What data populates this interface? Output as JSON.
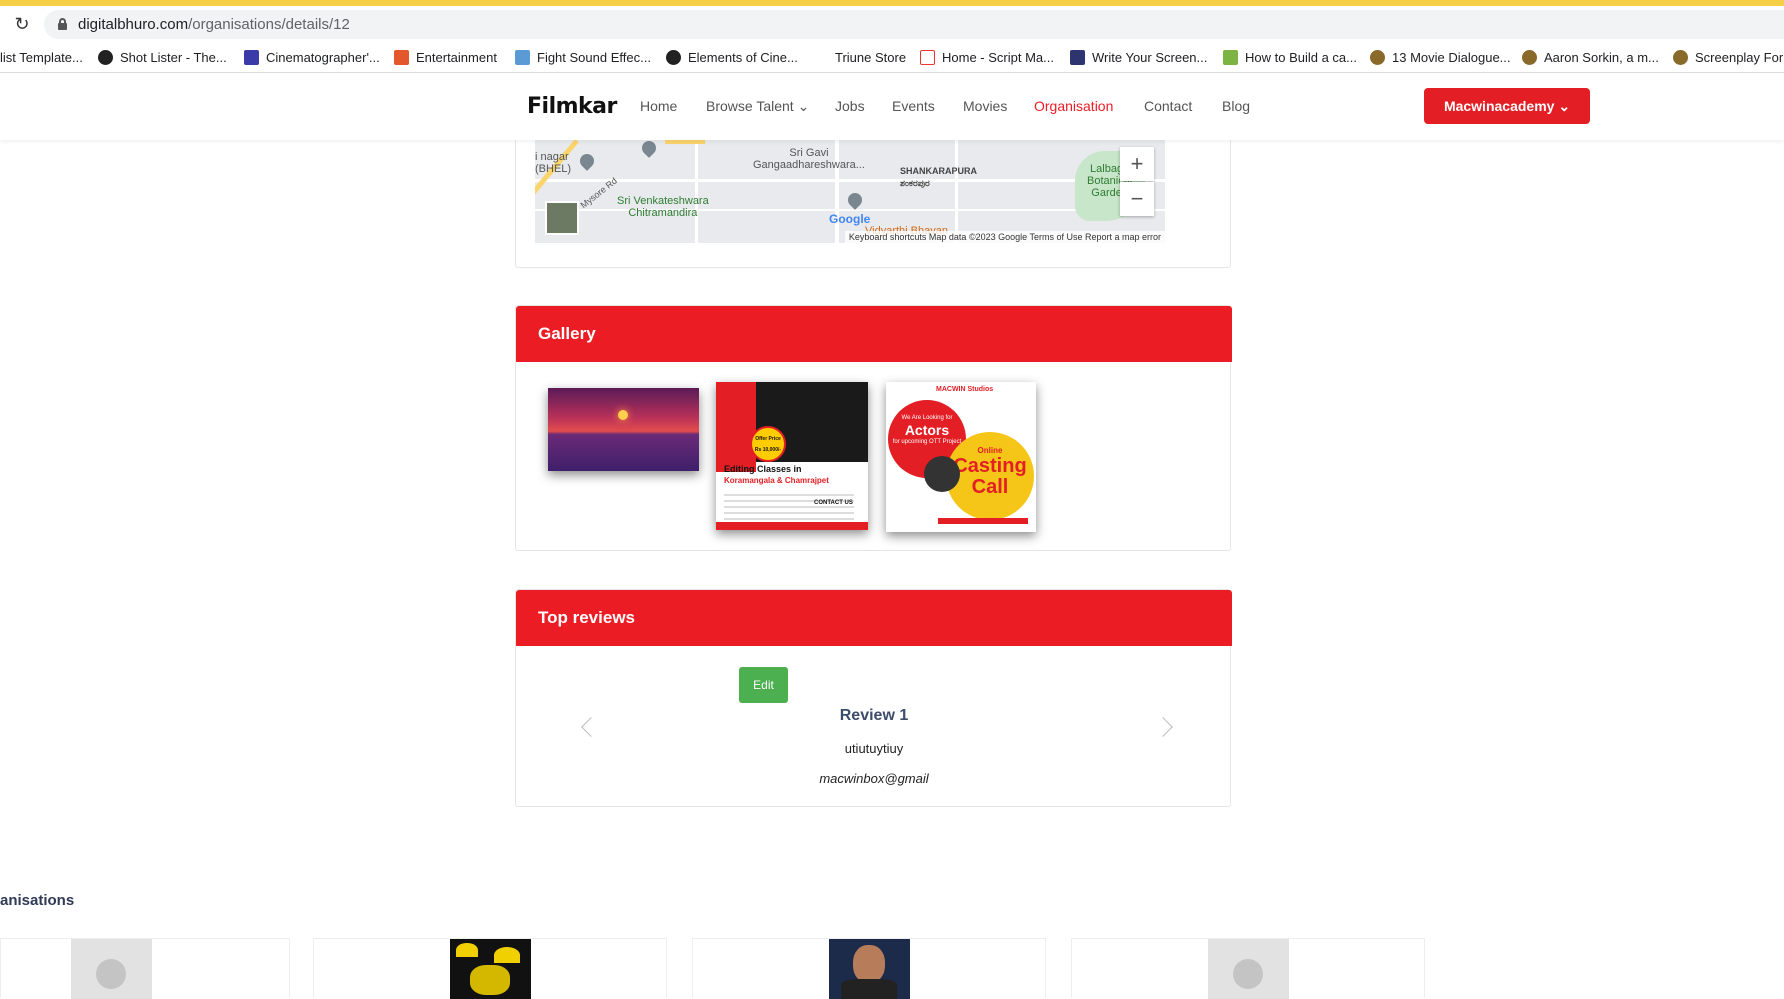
{
  "browser": {
    "url_domain": "digitalbhuro.com",
    "url_path": "/organisations/details/12",
    "bookmarks": [
      {
        "label": "list Template..."
      },
      {
        "label": "Shot Lister - The..."
      },
      {
        "label": "Cinematographer'..."
      },
      {
        "label": "Entertainment"
      },
      {
        "label": "Fight Sound Effec..."
      },
      {
        "label": "Elements of Cine..."
      },
      {
        "label": "Triune Store"
      },
      {
        "label": "Home - Script Ma..."
      },
      {
        "label": "Write Your Screen..."
      },
      {
        "label": "How to Build a ca..."
      },
      {
        "label": "13 Movie Dialogue..."
      },
      {
        "label": "Aaron Sorkin, a m..."
      },
      {
        "label": "Screenplay Form"
      }
    ]
  },
  "header": {
    "logo": "Filmkar",
    "nav": [
      {
        "label": "Home"
      },
      {
        "label": "Browse Talent ⌄"
      },
      {
        "label": "Jobs"
      },
      {
        "label": "Events"
      },
      {
        "label": "Movies"
      },
      {
        "label": "Organisation"
      },
      {
        "label": "Contact"
      },
      {
        "label": "Blog"
      }
    ],
    "user_button": "Macwinacademy ⌄",
    "accent": "#ec1c24"
  },
  "map": {
    "labels": {
      "l1": "i nagar\n(BHEL)",
      "l2": "Mysore Rd",
      "l3": "Sri Gavi\nGangaadhareshwara...",
      "l4": "SHANKARAPURA\nಶಂಕರಪುರ",
      "l5": "Lalbagh\nBotanical\nGarden",
      "l6": "Sri Venkateshwara\nChitramandira",
      "l7": "Google",
      "l8": "Vidyarthi Bhavan"
    },
    "zoom_in": "+",
    "zoom_out": "−",
    "attribution": "Keyboard shortcuts   Map data ©2023 Google   Terms of Use   Report a map error"
  },
  "gallery": {
    "title": "Gallery",
    "poster_editing": {
      "offer": "Offer Price Rs 10,000/-",
      "line1": "Editing Classes in",
      "line2": "Koramangala & Chamrajpet",
      "contact": "CONTACT US"
    },
    "poster_casting": {
      "brand": "MACWIN Studios",
      "small": "We Are Looking for",
      "actors": "Actors",
      "sub": "for upcoming OTT Project",
      "online": "Online",
      "casting": "Casting Call"
    }
  },
  "reviews": {
    "title": "Top reviews",
    "edit_label": "Edit",
    "items": [
      {
        "title": "Review 1",
        "text": "utiutuytiuy",
        "email": "macwinbox@gmail"
      }
    ]
  },
  "organisations": {
    "heading": "anisations"
  }
}
